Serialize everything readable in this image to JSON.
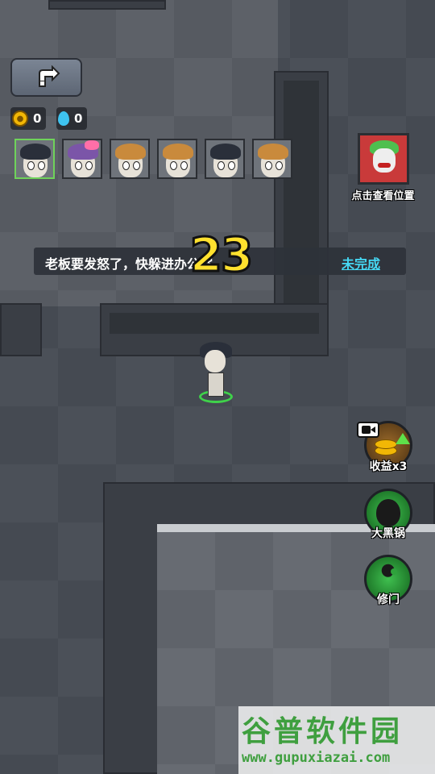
{
  "hud": {
    "back_button_icon": "return-arrow-icon",
    "coins": {
      "icon": "coin-icon",
      "value": "0"
    },
    "water": {
      "icon": "water-drop-icon",
      "value": "0"
    }
  },
  "roster": [
    {
      "role": "player",
      "hair_color": "#2a2f3a",
      "selected": true
    },
    {
      "role": "girl-pink-bow",
      "hair_color": "#7b55a8",
      "selected": false
    },
    {
      "role": "blonde",
      "hair_color": "#c98a3c",
      "selected": false
    },
    {
      "role": "blonde",
      "hair_color": "#c98a3c",
      "selected": false
    },
    {
      "role": "dark-hair",
      "hair_color": "#2a2f3a",
      "selected": false
    },
    {
      "role": "blonde",
      "hair_color": "#c98a3c",
      "selected": false
    }
  ],
  "boss_locator": {
    "icon": "boss-portrait-icon",
    "label": "点击查看位置"
  },
  "task": {
    "text": "老板要发怒了，快躲进办公室",
    "status": "未完成",
    "countdown": "23"
  },
  "side_buttons": [
    {
      "id": "income",
      "label": "收益x3",
      "icon": "coin-stack-upgrade-icon",
      "ad": true,
      "color": "#6b4a1a"
    },
    {
      "id": "cauldron",
      "label": "大黑锅",
      "icon": "black-pot-icon",
      "color": "#1e8a2e"
    },
    {
      "id": "repair",
      "label": "修门",
      "icon": "wrench-icon",
      "color": "#1e8a2e"
    }
  ],
  "watermark": {
    "title": "谷普软件园",
    "url": "www.gupuxiazai.com"
  },
  "colors": {
    "accent_cyan": "#46d9f5",
    "countdown_yellow": "#ffe12e",
    "selection_green": "#6fd35a"
  }
}
